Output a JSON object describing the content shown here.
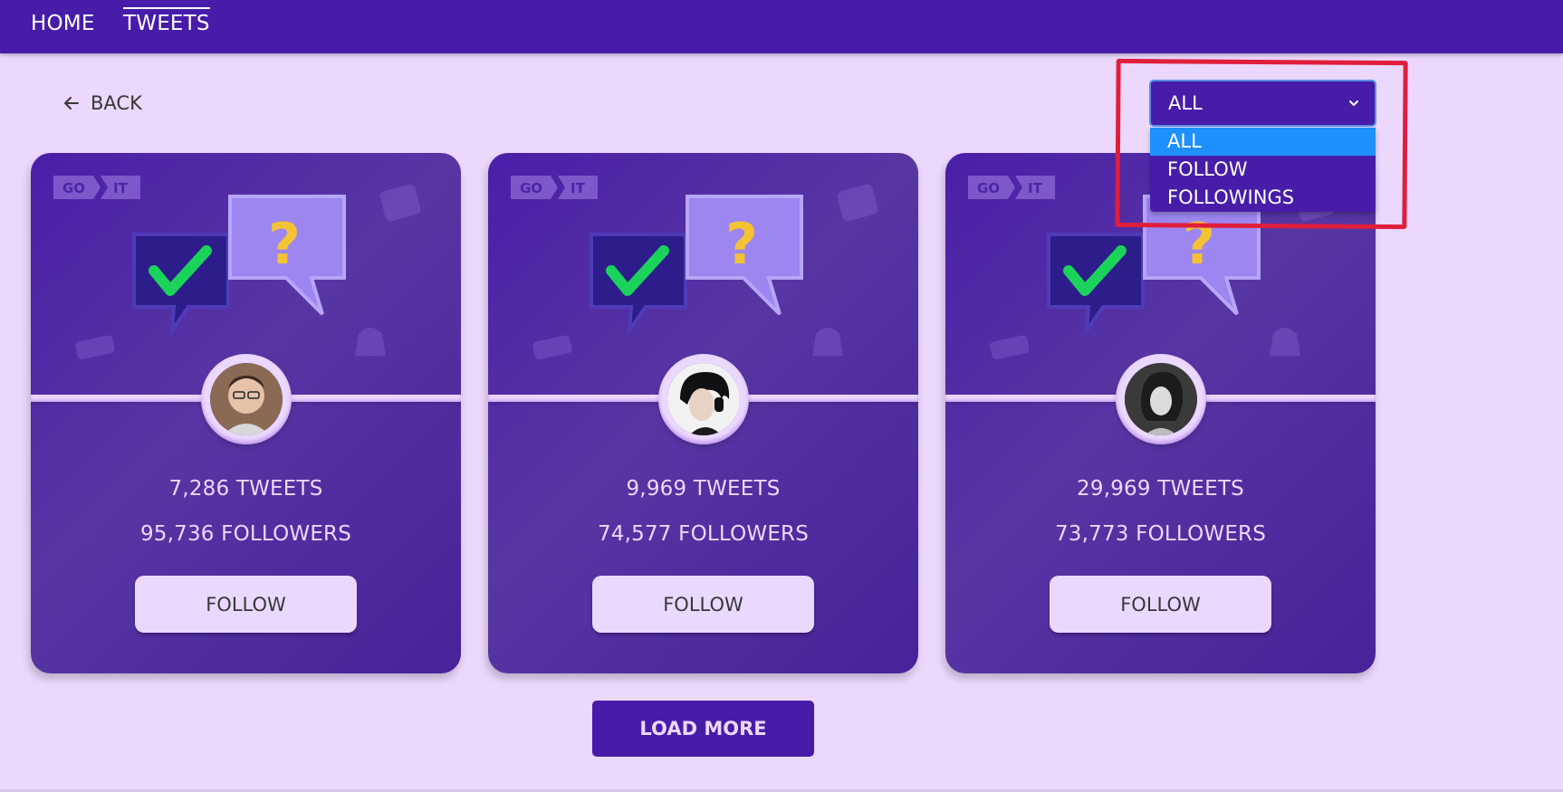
{
  "nav": {
    "home": "HOME",
    "tweets": "TWEETS"
  },
  "back": {
    "label": "BACK",
    "icon": "arrow-left-icon"
  },
  "filter": {
    "selected": "ALL",
    "options": [
      "ALL",
      "FOLLOW",
      "FOLLOWINGS"
    ],
    "highlighted": "ALL"
  },
  "cards": [
    {
      "logo": [
        "GO",
        "IT"
      ],
      "tweets": "7,286 TWEETS",
      "followers": "95,736 FOLLOWERS",
      "button": "FOLLOW"
    },
    {
      "logo": [
        "GO",
        "IT"
      ],
      "tweets": "9,969 TWEETS",
      "followers": "74,577 FOLLOWERS",
      "button": "FOLLOW"
    },
    {
      "logo": [
        "GO",
        "IT"
      ],
      "tweets": "29,969 TWEETS",
      "followers": "73,773 FOLLOWERS",
      "button": "FOLLOW"
    }
  ],
  "load_more": "LOAD MORE",
  "colors": {
    "primary": "#471ca9",
    "card": "#5736a3",
    "light": "#ebd8ff",
    "background": "#ebd8fc",
    "highlight": "#e01e3c",
    "option_selected": "#1e90ff"
  }
}
